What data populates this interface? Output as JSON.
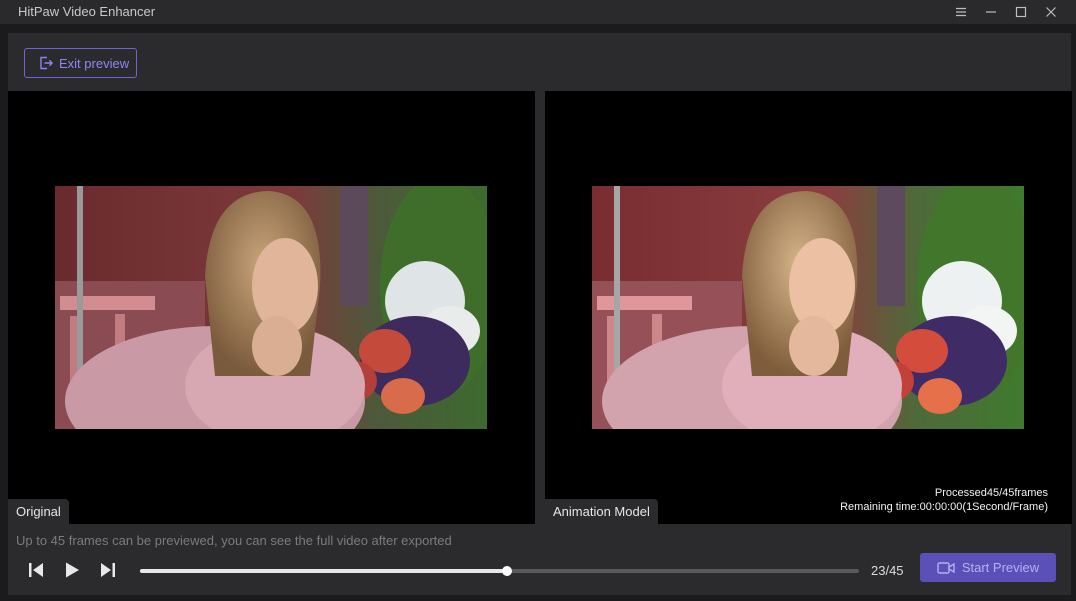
{
  "window": {
    "title": "HitPaw Video Enhancer"
  },
  "toolbar": {
    "exit_label": "Exit preview"
  },
  "panes": {
    "left_label": "Original",
    "right_label": "Animation Model",
    "processed": "Processed45/45frames",
    "remaining": "Remaining time:00:00:00(1Second/Frame)"
  },
  "footer": {
    "hint": "Up to 45 frames can be previewed, you can see the full video after exported",
    "counter": "23/45",
    "progress": 0.51,
    "start_label": "Start Preview"
  },
  "colors": {
    "accent": "#5b50b8",
    "accent_text": "#8e84f5",
    "background": "#2b2b2e"
  }
}
